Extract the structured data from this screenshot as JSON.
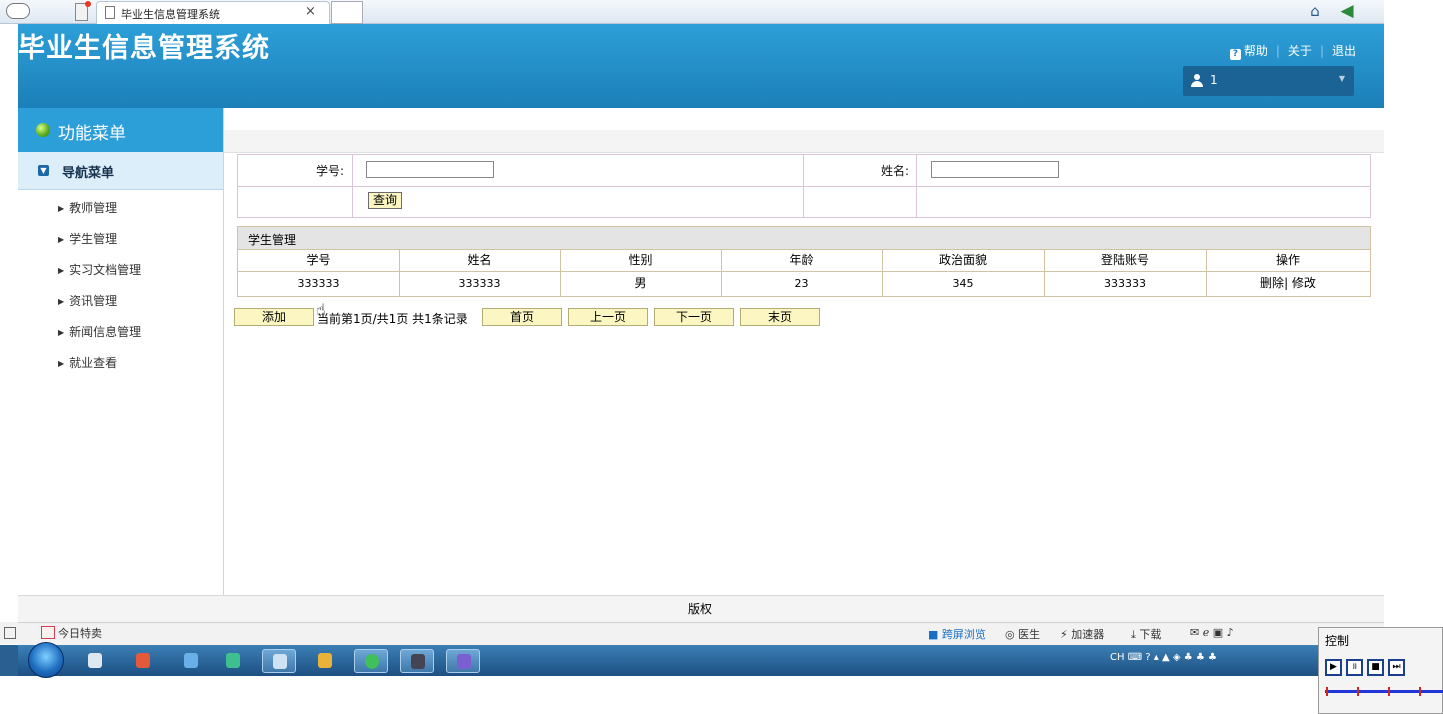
{
  "browser": {
    "tab_title": "毕业生信息管理系统",
    "tab_close": "×"
  },
  "app": {
    "title": "毕业生信息管理系统",
    "links": {
      "help": "帮助",
      "about": "关于",
      "logout": "退出"
    },
    "user": "1"
  },
  "sidebar": {
    "menu_title": "功能菜单",
    "nav_title": "导航菜单",
    "items": [
      {
        "label": "教师管理"
      },
      {
        "label": "学生管理"
      },
      {
        "label": "实习文档管理"
      },
      {
        "label": "资讯管理"
      },
      {
        "label": "新闻信息管理"
      },
      {
        "label": "就业查看"
      }
    ]
  },
  "search": {
    "student_id_label": "学号:",
    "name_label": "姓名:",
    "student_id_value": "",
    "name_value": "",
    "query_button": "查询"
  },
  "table": {
    "caption": "学生管理",
    "columns": [
      "学号",
      "姓名",
      "性别",
      "年龄",
      "政治面貌",
      "登陆账号",
      "操作"
    ],
    "rows": [
      {
        "id": "333333",
        "name": "333333",
        "gender": "男",
        "age": "23",
        "political": "345",
        "account": "333333",
        "delete": "删除",
        "edit": "修改"
      }
    ]
  },
  "pager": {
    "add": "添加",
    "info": "当前第1页/共1页  共1条记录",
    "first": "首页",
    "prev": "上一页",
    "next": "下一页",
    "last": "末页"
  },
  "footer": {
    "copyright": "版权"
  },
  "statusbar": {
    "today": "今日特卖",
    "items": [
      "跨屏浏览",
      "医生",
      "加速器",
      "下载"
    ]
  },
  "tray": {
    "lang": "CH"
  },
  "media_control": {
    "title": "控制"
  },
  "colors": {
    "header_blue": "#2d9fd8",
    "button_yellow": "#fcf7c2",
    "sidebar_active": "#dceefa"
  }
}
